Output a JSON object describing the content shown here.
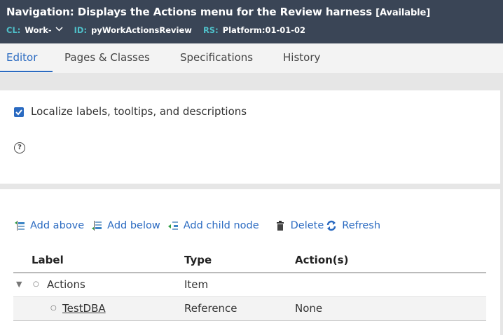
{
  "header": {
    "title": "Navigation: Displays the Actions menu for the Review harness",
    "status": "[Available]",
    "cl_label": "CL:",
    "cl_value": "Work-",
    "id_label": "ID:",
    "id_value": "pyWorkActionsReview",
    "rs_label": "RS:",
    "rs_value": "Platform:01-01-02"
  },
  "tabs": [
    {
      "label": "Editor",
      "active": true
    },
    {
      "label": "Pages & Classes"
    },
    {
      "label": "Specifications"
    },
    {
      "label": "History"
    }
  ],
  "editor": {
    "localize_label": "Localize labels, tooltips, and descriptions",
    "localize_checked": true,
    "help_glyph": "?"
  },
  "toolbar": {
    "add_above": "Add above",
    "add_below": "Add below",
    "add_child": "Add child node",
    "delete": "Delete",
    "refresh": "Refresh"
  },
  "table": {
    "headers": [
      "Label",
      "Type",
      "Action(s)"
    ],
    "rows": [
      {
        "label": "Actions",
        "type": "Item",
        "action": ""
      },
      {
        "label": "TestDBA",
        "type": "Reference",
        "action": "None"
      }
    ]
  },
  "colors": {
    "header_bg": "#3a4556",
    "accent": "#2a6ac1",
    "meta_key": "#4fc0c9"
  }
}
